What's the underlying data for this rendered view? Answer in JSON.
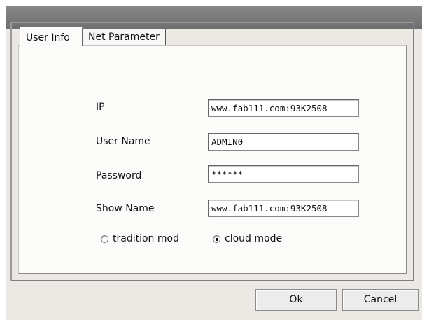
{
  "tabs": [
    {
      "label": "User Info",
      "active": true
    },
    {
      "label": "Net Parameter",
      "active": false
    }
  ],
  "form": {
    "ip": {
      "label": "IP",
      "value": "www.fab111.com:93K2508"
    },
    "user_name": {
      "label": "User Name",
      "value": "ADMIN0"
    },
    "password": {
      "label": "Password",
      "value": "******"
    },
    "show_name": {
      "label": "Show Name",
      "value": "www.fab111.com:93K2508"
    },
    "mode": {
      "options": [
        {
          "label": "tradition mod",
          "selected": false
        },
        {
          "label": "cloud mode",
          "selected": true
        }
      ]
    }
  },
  "buttons": {
    "ok": "Ok",
    "cancel": "Cancel"
  },
  "colors": {
    "titlebar": "#7a7a7a",
    "dialog_bg": "#ece9e4",
    "panel_bg": "#fbfbfa"
  }
}
